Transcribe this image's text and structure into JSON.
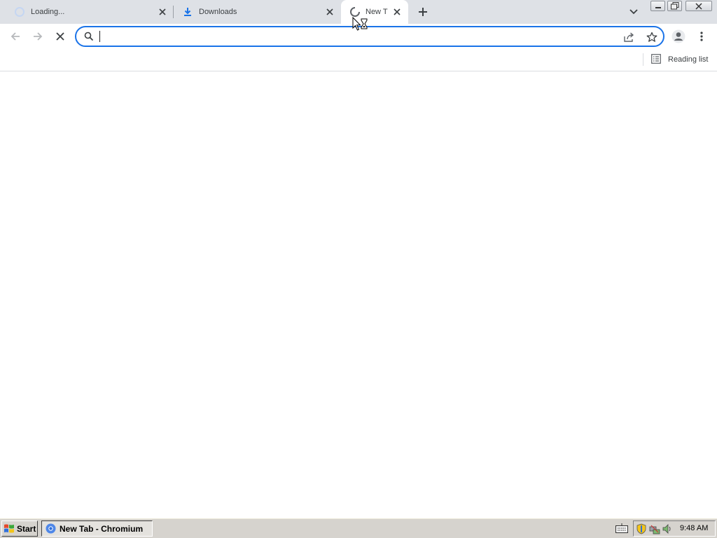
{
  "browser": {
    "tabs": [
      {
        "title": "Loading...",
        "icon": "loading-spinner-icon",
        "active": false
      },
      {
        "title": "Downloads",
        "icon": "download-icon",
        "active": false
      },
      {
        "title": "New T",
        "icon": "loading-spinner-icon",
        "active": true
      }
    ],
    "omnibox": {
      "value": "",
      "placeholder": ""
    },
    "bookmarks_bar": {
      "reading_list_label": "Reading list"
    },
    "accent_color": "#1a73e8"
  },
  "taskbar": {
    "start_label": "Start",
    "task_item_label": "New Tab - Chromium",
    "clock": "9:48 AM"
  }
}
